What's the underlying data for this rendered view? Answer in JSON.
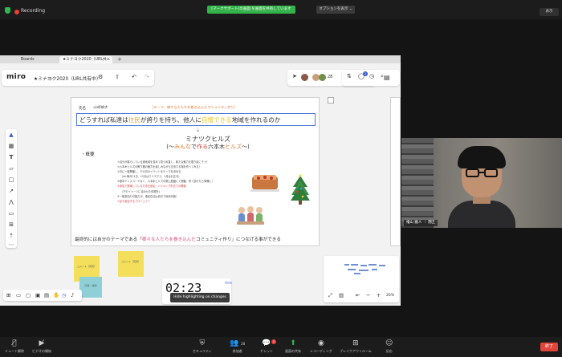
{
  "zoom_top": {
    "recording_label": "Recording",
    "share_notice": "[マークサポート]の画面 を画面を共有しています",
    "options_label": "オプションを表示 ⌄",
    "view_label": "表示"
  },
  "browser": {
    "tabs": [
      {
        "label": "Boards"
      },
      {
        "label": "★ミナヨク2020（URL共..."
      }
    ],
    "tab_close": "×",
    "tab_add": "+"
  },
  "miro": {
    "logo": "miro",
    "board_name": "★ミナヨク2020（URL共有中）",
    "participant_count": "28",
    "notification_count": "2"
  },
  "document": {
    "name_label": "氏名",
    "name_value": "山崎雄太",
    "theme": "［テーマ：様々な人たちを巻き込んだコミュニティ作り］",
    "headline": {
      "part1": "どうすれば私達は",
      "hl1": "住民",
      "part2": "が誇りを持ち、他人に",
      "hl2": "自慢できる",
      "part3": "地域を作れるのか"
    },
    "title": "ミナツクヒルズ",
    "subtitle": {
      "p1": "(〜",
      "hl1": "みんな",
      "p2": "で",
      "hl2": "作る",
      "p3": "六本木",
      "hl3": "ヒルズ",
      "p4": "〜)"
    },
    "overview_label": "・概要",
    "points": [
      {
        "text": "①自分が暮らしている港地域を並めて見つめ直し、新たな魅力を掘り起こそう！",
        "style": "normal"
      },
      {
        "text": "②六本木ヒルズの飾り棚の魅力を楽しみながら交流する場を作ってみる！",
        "style": "normal"
      },
      {
        "text": "③月に一度開催し、その月のイベントをテーマを決める",
        "style": "normal"
      },
      {
        "text": "(ex.毎月11日、12月はクリスマス、1月はお正月)",
        "style": "sub"
      },
      {
        "text": "④基本ドレスコードなく、六本木ヒルズの屋上庭園にて開催、来て頂けたら準備に！",
        "style": "normal"
      },
      {
        "text": "⑤参加で提案している方法を設定、バイキング形式での開催",
        "style": "red"
      },
      {
        "text": "(下のイメージに合わせた料理を)",
        "style": "sub"
      },
      {
        "text": "⑥一般参加も可能だが、港区在住は割引で利用可能！",
        "style": "normal"
      },
      {
        "text": "⑦区も参加するプロジェクト",
        "style": "red"
      }
    ],
    "footline": {
      "p1": "最終的には自分のテーマである「",
      "hl": "様々な人たちを巻き込んだ",
      "p2": "コミュニティ作り」につなげる事ができる"
    }
  },
  "stickies": [
    {
      "label": "コメント（高見）"
    },
    {
      "label": "コメント（高見）"
    },
    {
      "label": "同様・議題"
    }
  ],
  "timer": {
    "value": "02:23",
    "hide_label": "Hide"
  },
  "tooltip": "Hide highlighting on changes",
  "minimap": {
    "zoom_level": "26%"
  },
  "video": {
    "participant_label": "檜山 雅人 ｜ 港区"
  },
  "zoom_bottom": {
    "items": [
      {
        "label": "ミュート解除",
        "icon": "mic-muted-icon"
      },
      {
        "label": "ビデオの開始",
        "icon": "video-off-icon"
      },
      {
        "label": "セキュリティ",
        "icon": "shield-icon"
      },
      {
        "label": "参加者",
        "count": "28",
        "icon": "participants-icon"
      },
      {
        "label": "チャット",
        "badge": "1",
        "icon": "chat-icon"
      },
      {
        "label": "画面の共有",
        "icon": "share-screen-icon"
      },
      {
        "label": "レコーディング",
        "icon": "record-icon"
      },
      {
        "label": "ブレイクアウトルーム",
        "icon": "breakout-icon"
      },
      {
        "label": "反応",
        "icon": "reaction-icon"
      }
    ],
    "end_label": "終了"
  },
  "colors": {
    "zoom_green": "#2fb84f",
    "end_red": "#e0463b",
    "headline_border": "#4a7bd8",
    "sticky_yellow": "#f4df5c",
    "sticky_teal": "#8fd0d8"
  }
}
